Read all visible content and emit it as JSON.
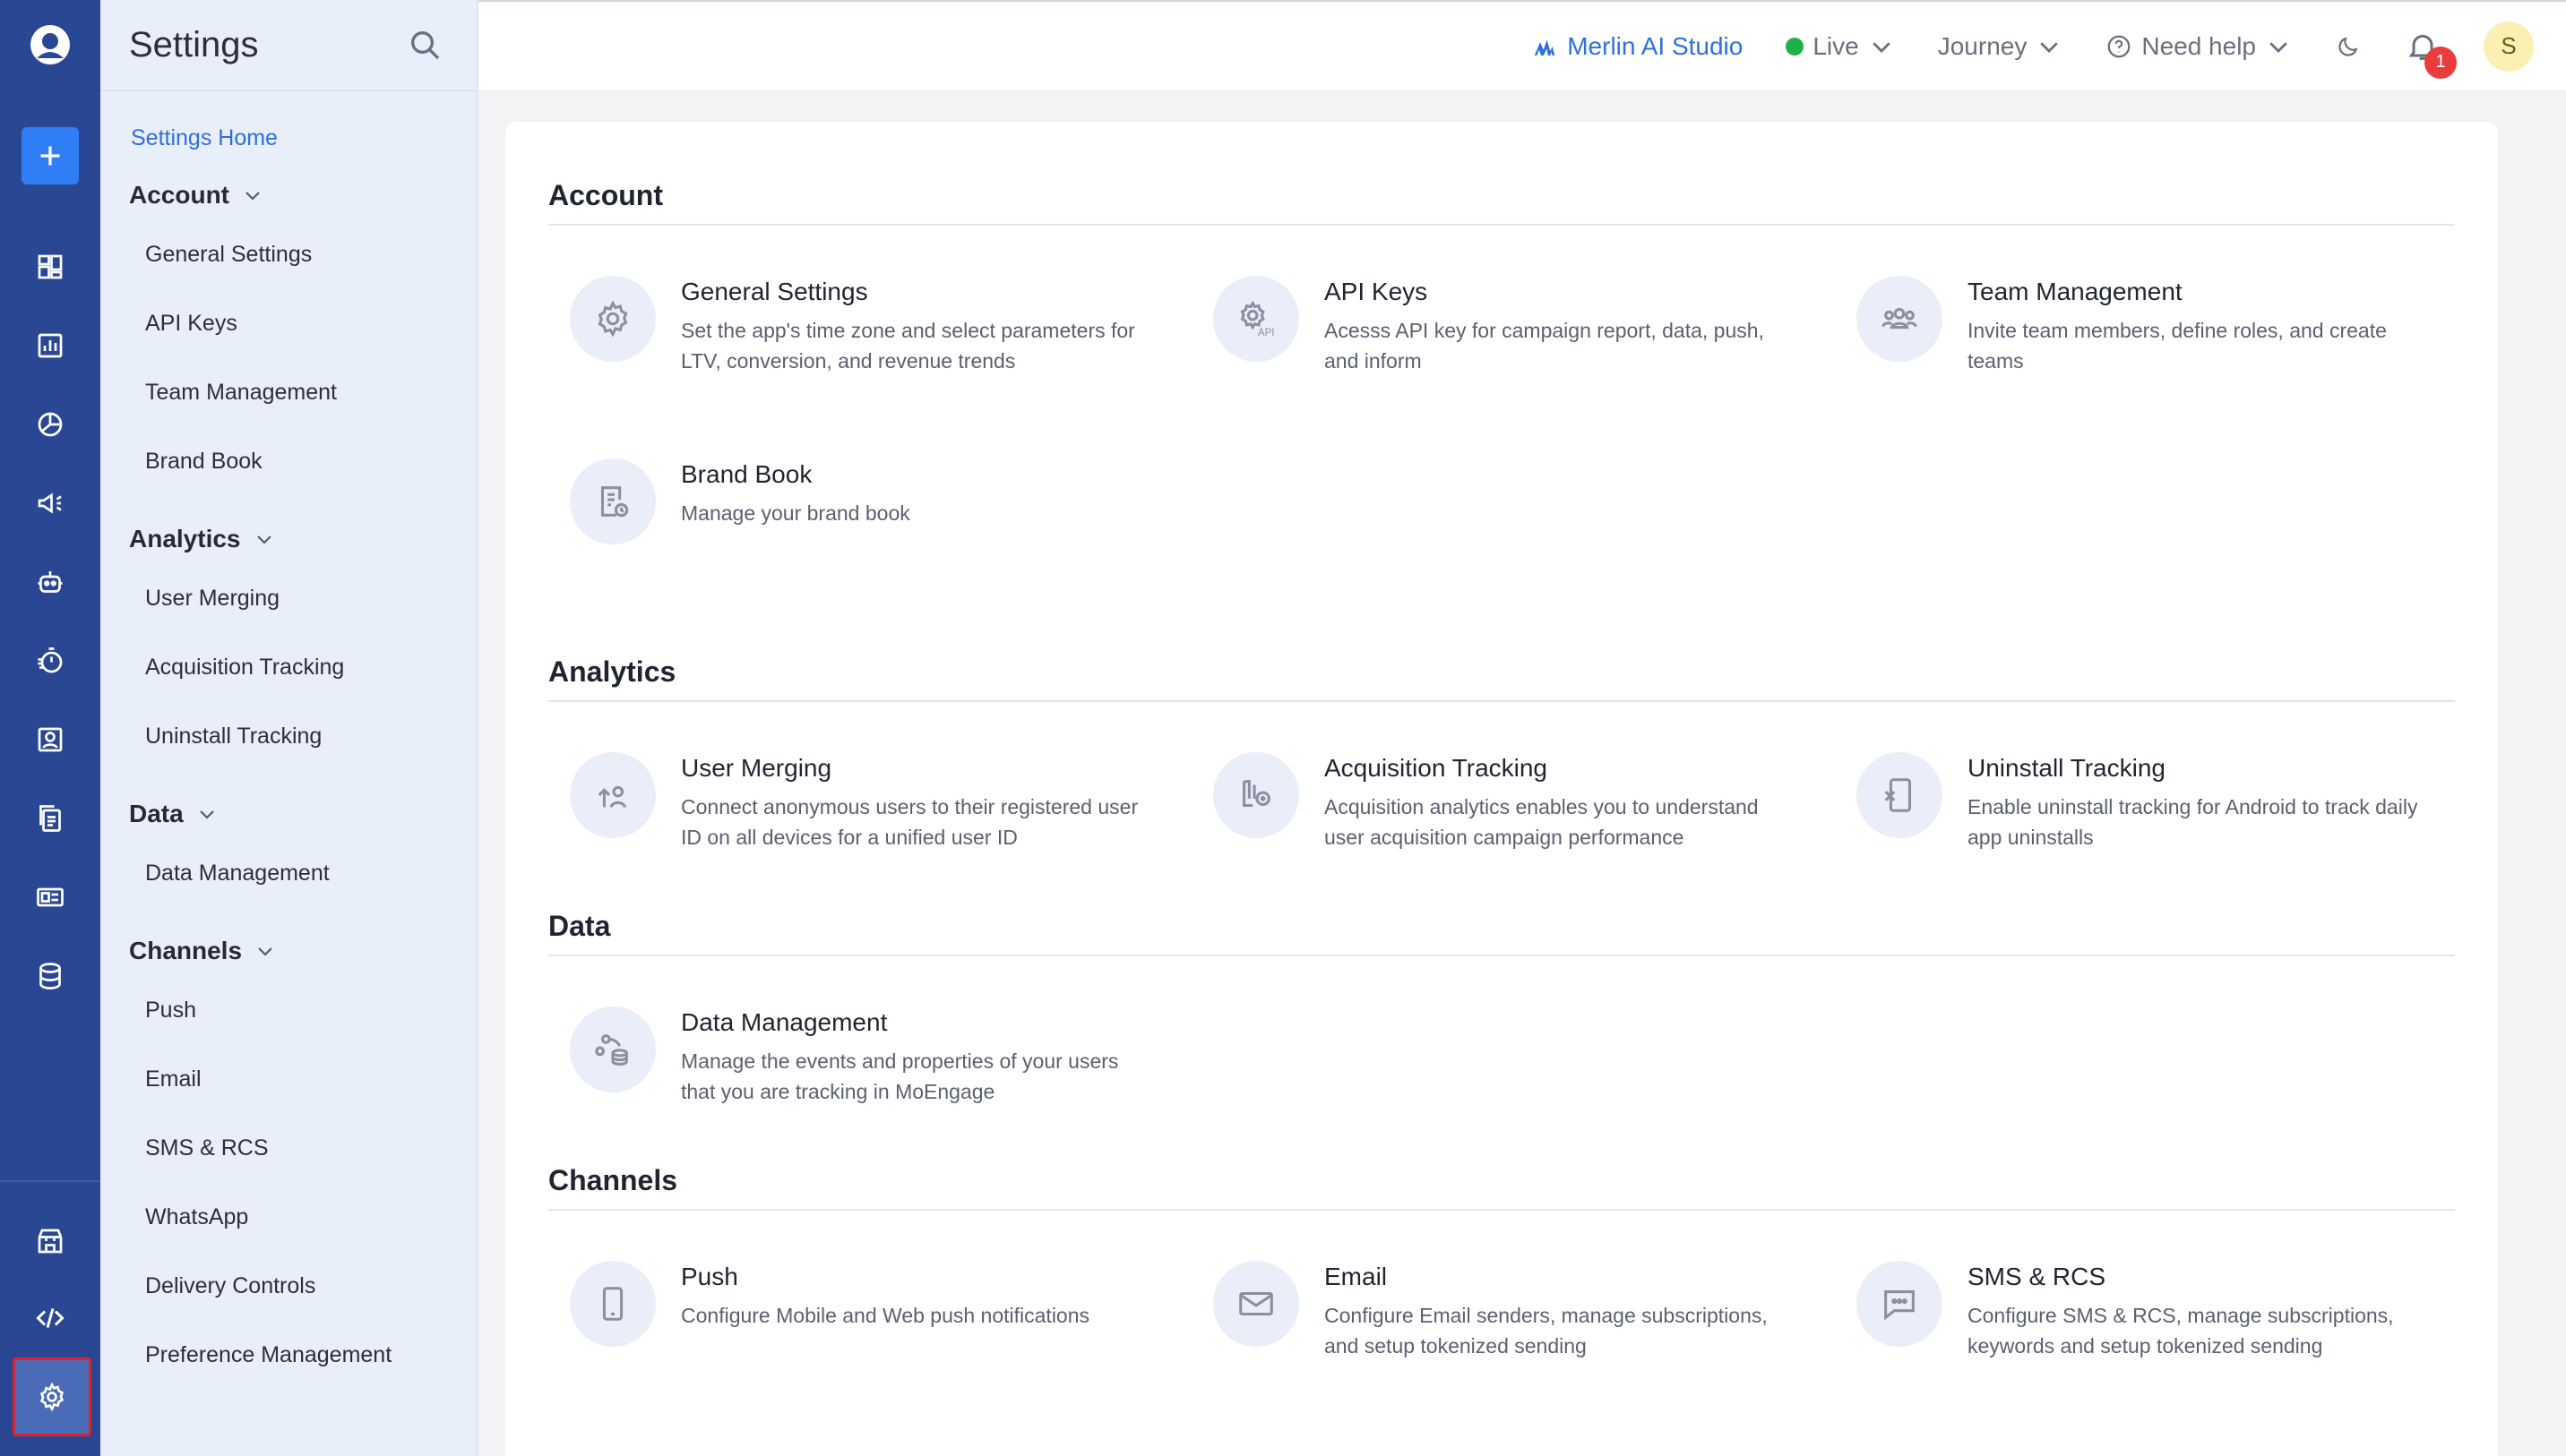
{
  "rail": {
    "icons": [
      "logo-icon",
      "add-icon",
      "dashboard-icon",
      "analytics-icon",
      "segment-icon",
      "campaign-icon",
      "bot-icon",
      "timer-icon",
      "user-profile-icon",
      "content-icon",
      "catalog-icon",
      "database-icon",
      "store-icon",
      "code-icon",
      "gear-icon"
    ]
  },
  "subnav": {
    "title": "Settings",
    "home": "Settings Home",
    "groups": [
      {
        "label": "Account",
        "items": [
          "General Settings",
          "API Keys",
          "Team Management",
          "Brand Book"
        ]
      },
      {
        "label": "Analytics",
        "items": [
          "User Merging",
          "Acquisition Tracking",
          "Uninstall Tracking"
        ]
      },
      {
        "label": "Data",
        "items": [
          "Data Management"
        ]
      },
      {
        "label": "Channels",
        "items": [
          "Push",
          "Email",
          "SMS & RCS",
          "WhatsApp",
          "Delivery Controls",
          "Preference Management"
        ]
      }
    ]
  },
  "topbar": {
    "merlin": "Merlin AI Studio",
    "env": "Live",
    "journey": "Journey",
    "help": "Need help",
    "notifications": "1",
    "avatar": "S"
  },
  "sections": [
    {
      "title": "Account",
      "cards": [
        {
          "title": "General Settings",
          "desc": "Set the app's time zone and select parameters for LTV, conversion, and revenue trends",
          "icon": "gear-icon"
        },
        {
          "title": "API Keys",
          "desc": "Acesss API key for campaign report, data, push, and inform",
          "icon": "api-gear-icon"
        },
        {
          "title": "Team Management",
          "desc": "Invite team members, define roles, and create teams",
          "icon": "team-icon"
        },
        {
          "title": "Brand Book",
          "desc": "Manage your brand book",
          "icon": "brand-book-icon"
        }
      ]
    },
    {
      "title": "Analytics",
      "cards": [
        {
          "title": "User Merging",
          "desc": "Connect anonymous users to their registered user ID on all devices for a unified user ID",
          "icon": "user-merge-icon"
        },
        {
          "title": "Acquisition Tracking",
          "desc": "Acquisition analytics enables you to understand user acquisition campaign performance",
          "icon": "acquisition-icon"
        },
        {
          "title": "Uninstall Tracking",
          "desc": "Enable uninstall tracking for Android to track daily app uninstalls",
          "icon": "uninstall-icon"
        }
      ]
    },
    {
      "title": "Data",
      "cards": [
        {
          "title": "Data Management",
          "desc": "Manage the events and properties of your users that you are tracking in MoEngage",
          "icon": "data-management-icon"
        }
      ]
    },
    {
      "title": "Channels",
      "cards": [
        {
          "title": "Push",
          "desc": "Configure Mobile and Web push notifications",
          "icon": "mobile-icon"
        },
        {
          "title": "Email",
          "desc": "Configure Email senders, manage subscriptions, and setup tokenized sending",
          "icon": "mail-icon"
        },
        {
          "title": "SMS & RCS",
          "desc": "Configure SMS & RCS, manage subscriptions, keywords and setup tokenized sending",
          "icon": "chat-icon"
        }
      ]
    }
  ]
}
